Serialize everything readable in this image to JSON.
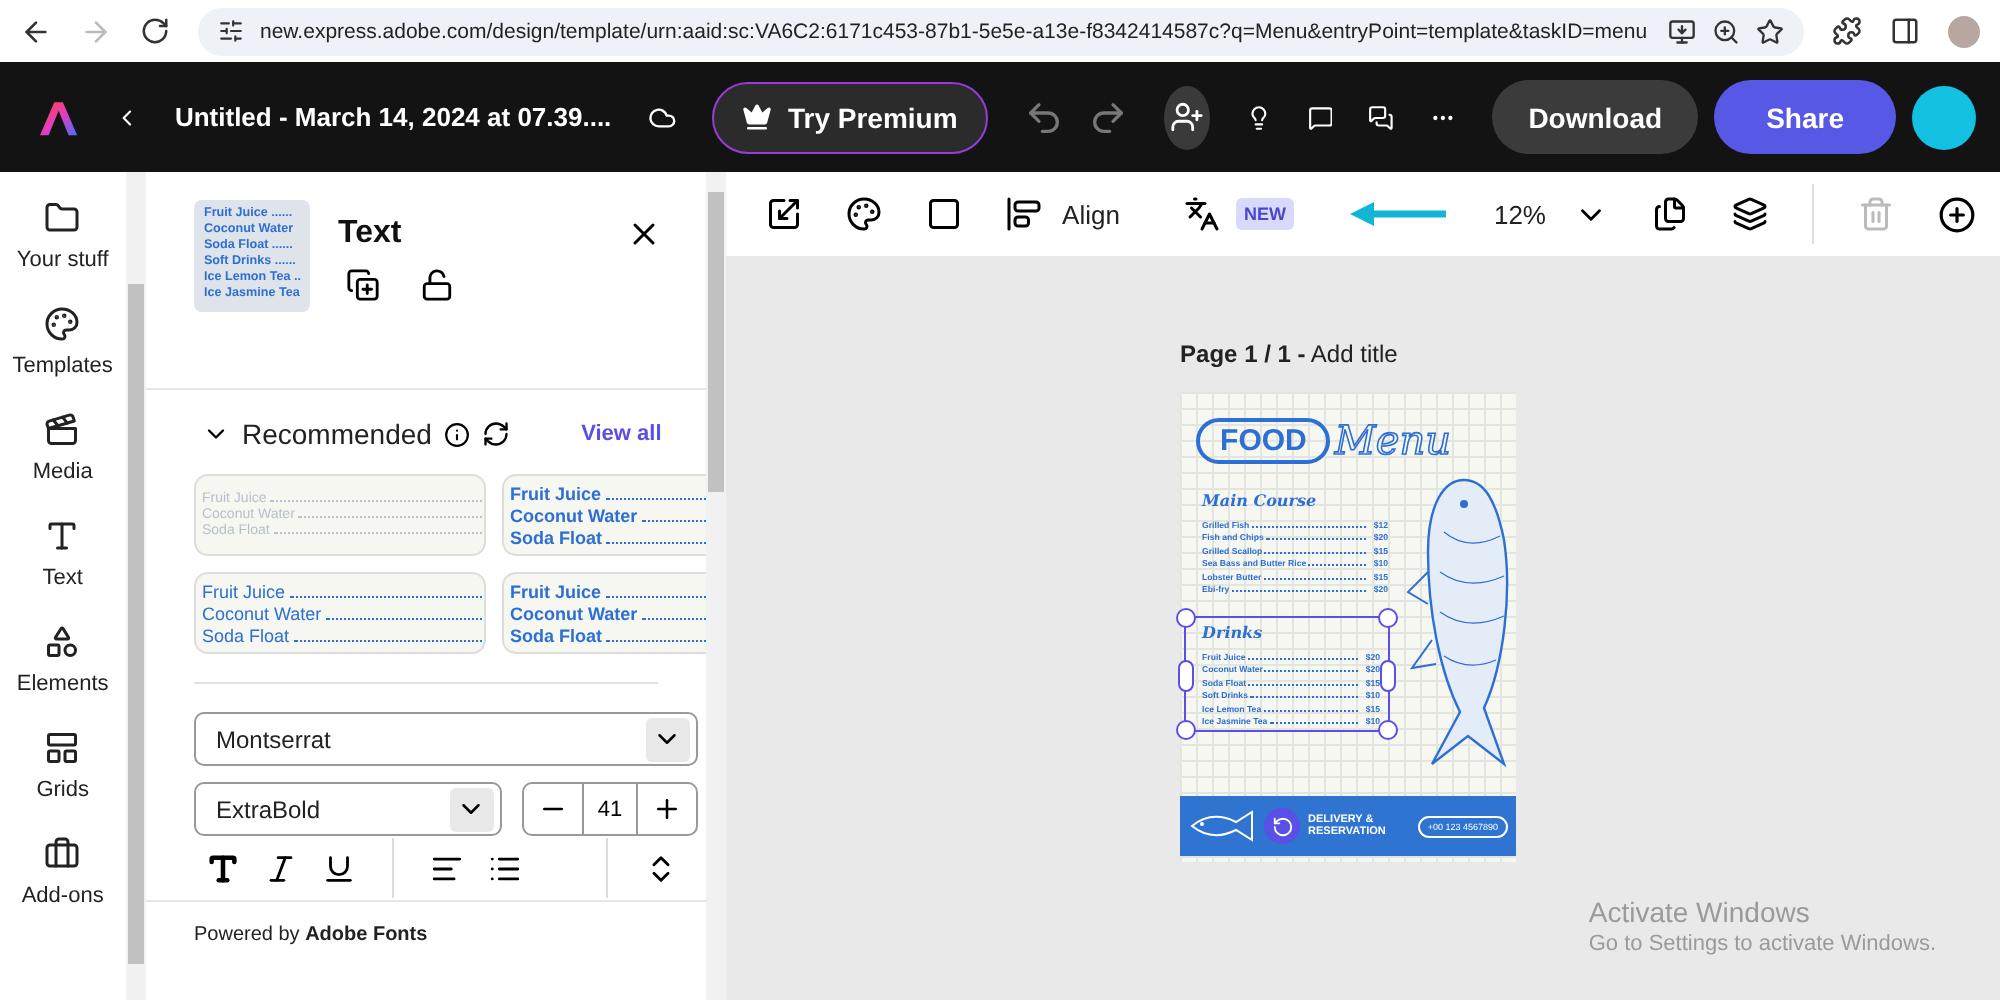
{
  "browser": {
    "url": "new.express.adobe.com/design/template/urn:aaid:sc:VA6C2:6171c453-87b1-5e5e-a13e-f8342414587c?q=Menu&entryPoint=template&taskID=menu",
    "forward_disabled": true
  },
  "header": {
    "document_title": "Untitled - March 14, 2024 at 07.39....",
    "premium_button": "Try Premium",
    "undo_disabled": true,
    "redo_disabled": true,
    "download_button": "Download",
    "share_button": "Share"
  },
  "rail": [
    {
      "label": "Your stuff",
      "kind": "folder"
    },
    {
      "label": "Templates",
      "kind": "templates"
    },
    {
      "label": "Media",
      "kind": "media"
    },
    {
      "label": "Text",
      "kind": "text"
    },
    {
      "label": "Elements",
      "kind": "elements"
    },
    {
      "label": "Grids",
      "kind": "grids"
    },
    {
      "label": "Add-ons",
      "kind": "addons"
    }
  ],
  "panel": {
    "title": "Text",
    "thumbnail_lines": [
      "Fruit Juice ......",
      "Coconut Water",
      "Soda Float ......",
      "Soft Drinks ......",
      "Ice Lemon Tea ..",
      "Ice Jasmine Tea"
    ],
    "section": "Recommended",
    "view_all": "View all",
    "presets": [
      {
        "kind": "thin",
        "lines": [
          "Fruit Juice",
          "Coconut Water",
          "Soda Float"
        ]
      },
      {
        "kind": "bold",
        "lines": [
          "Fruit Juice",
          "Coconut Water",
          "Soda Float"
        ]
      },
      {
        "kind": "regular",
        "lines": [
          "Fruit Juice",
          "Coconut Water",
          "Soda Float"
        ]
      },
      {
        "kind": "bold",
        "lines": [
          "Fruit Juice",
          "Coconut Water",
          "Soda Float"
        ]
      }
    ],
    "font": "Montserrat",
    "weight": "ExtraBold",
    "size": "41",
    "footer": "Powered by **Adobe Fonts**"
  },
  "toolbar": {
    "align": "Align",
    "badge": "NEW",
    "zoom": "12%",
    "delete_disabled": true
  },
  "canvas": {
    "page_label": "**Page 1 / 1 -** Add title",
    "poster": {
      "title_left": "FOOD",
      "title_right": "Menu",
      "sections": [
        {
          "heading": "Main Course",
          "selected": false,
          "items": [
            {
              "name": "Grilled Fish",
              "price": "$12"
            },
            {
              "name": "Fish and Chips",
              "price": "$20"
            },
            {
              "name": "Grilled Scallop",
              "price": "$15"
            },
            {
              "name": "Sea Bass and Butter Rice",
              "price": "$10"
            },
            {
              "name": "Lobster Butter",
              "price": "$15"
            },
            {
              "name": "Ebi-fry",
              "price": "$20"
            }
          ]
        },
        {
          "heading": "Drinks",
          "selected": true,
          "items": [
            {
              "name": "Fruit Juice",
              "price": "$20"
            },
            {
              "name": "Coconut Water",
              "price": "$20"
            },
            {
              "name": "Soda Float",
              "price": "$15"
            },
            {
              "name": "Soft Drinks",
              "price": "$10"
            },
            {
              "name": "Ice Lemon Tea",
              "price": "$15"
            },
            {
              "name": "Ice Jasmine Tea",
              "price": "$10"
            }
          ]
        }
      ],
      "footer_lines": [
        "DELIVERY &",
        "RESERVATION"
      ],
      "phone": "+00 123 4567890"
    }
  },
  "notice": {
    "title": "Activate Windows",
    "text": "Go to Settings to activate Windows."
  }
}
